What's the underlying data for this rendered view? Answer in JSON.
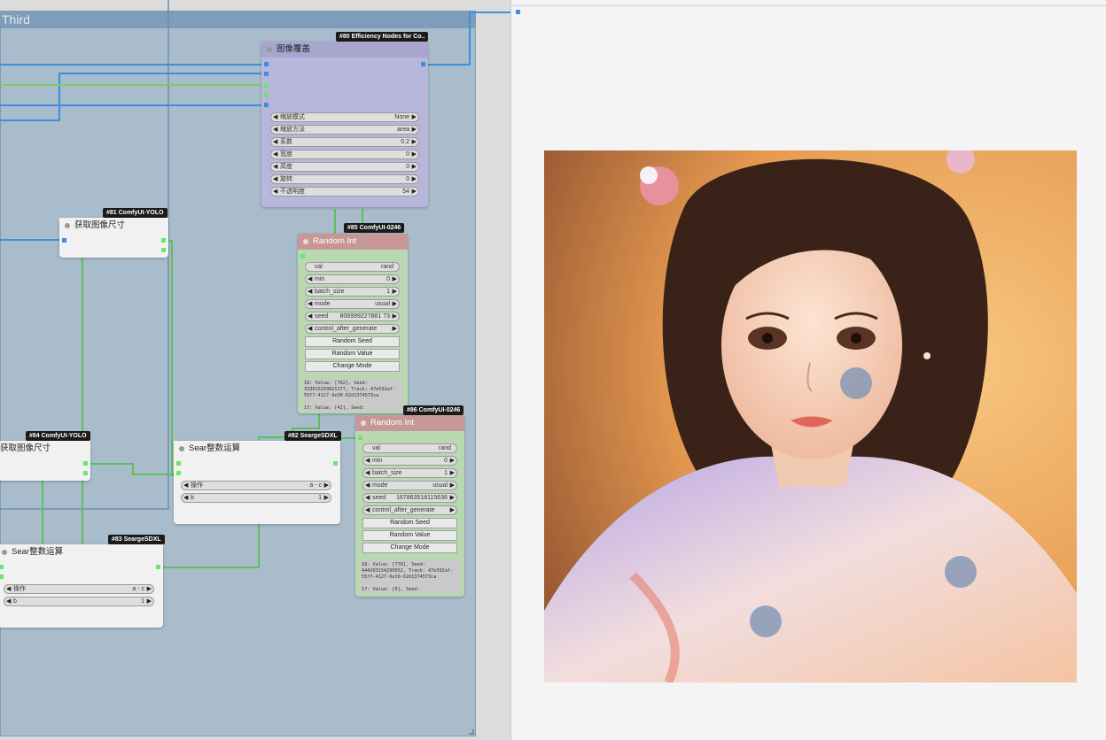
{
  "group": {
    "title": "Third"
  },
  "nodes": {
    "n80": {
      "badge": "#80 Efficiency Nodes for Co..",
      "title": "图像覆盖",
      "widgets": [
        {
          "label": "缩放模式",
          "value": "None"
        },
        {
          "label": "缩放方法",
          "value": "area"
        },
        {
          "label": "系数",
          "value": "0.2"
        },
        {
          "label": "宽度",
          "value": "0"
        },
        {
          "label": "高度",
          "value": "0"
        },
        {
          "label": "旋转",
          "value": "0"
        },
        {
          "label": "不透明度",
          "value": "54"
        }
      ]
    },
    "n81": {
      "badge": "#81 ComfyUI-YOLO",
      "title": "获取图像尺寸"
    },
    "n84": {
      "badge": "#84 ComfyUI-YOLO",
      "title": "获取图像尺寸"
    },
    "n85": {
      "badge": "#85 ComfyUI-0246",
      "title": "Random Int",
      "widgets": [
        {
          "label": "val",
          "value": "rand"
        },
        {
          "label": "min",
          "value": "0"
        },
        {
          "label": "batch_size",
          "value": "1"
        },
        {
          "label": "mode",
          "value": "usual"
        },
        {
          "label": "seed",
          "value": "806999227881 73"
        },
        {
          "label": "control_after_generate",
          "value": ""
        }
      ],
      "buttons": [
        "Random Seed",
        "Random Value",
        "Change Mode"
      ],
      "log": "18: Value: [782], Seed:\n333815293815177, Track: 47e592af-\n55f7-4127-9e30-62d1374573ca\n\n17: Value: [42], Seed:"
    },
    "n86": {
      "badge": "#86 ComfyUI-0246",
      "title": "Random Int",
      "widgets": [
        {
          "label": "val",
          "value": "rand"
        },
        {
          "label": "min",
          "value": "0"
        },
        {
          "label": "batch_size",
          "value": "1"
        },
        {
          "label": "mode",
          "value": "usual"
        },
        {
          "label": "seed",
          "value": "167863518115636"
        },
        {
          "label": "control_after_generate",
          "value": ""
        }
      ],
      "buttons": [
        "Random Seed",
        "Random Value",
        "Change Mode"
      ],
      "log": "18: Value: [778], Seed:\n444203154290952, Track: 47e592af-\n55f7-4127-9e30-62d1374573ca\n\n17: Value: [0], Seed:"
    },
    "n82": {
      "badge": "#82 SeargeSDXL",
      "title": "Sear整数运算",
      "widgets": [
        {
          "label": "操作",
          "value": "a - c"
        },
        {
          "label": "b",
          "value": "1"
        }
      ]
    },
    "n83": {
      "badge": "#83 SeargeSDXL",
      "title": "Sear整数运算",
      "widgets": [
        {
          "label": "操作",
          "value": "a - c"
        },
        {
          "label": "b",
          "value": "1"
        }
      ]
    }
  },
  "preview": {
    "description_alt": "preview image"
  },
  "colors": {
    "group_bg": "#a9bccb",
    "wire_blue": "#3a8fe0",
    "wire_green": "#5dbf5d",
    "node_purple": "#b8b6dd",
    "node_green_body": "#b9d8b2",
    "node_red_header": "#c99a9a"
  }
}
